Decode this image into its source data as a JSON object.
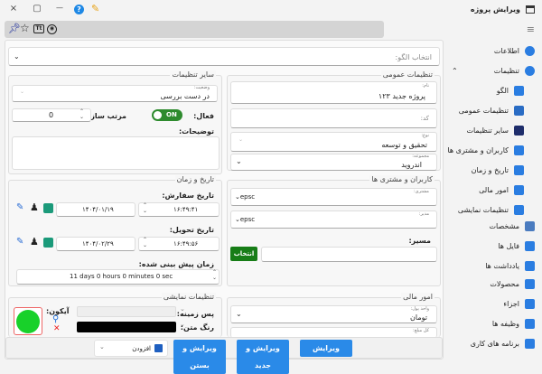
{
  "window": {
    "title": "ویرایش پروژه",
    "close": "×",
    "maximize": "▢",
    "minimize": "—",
    "help": "?"
  },
  "toolbar": {
    "icons": [
      "pin-icon",
      "star-icon",
      "text-format-icon",
      "eye-icon"
    ]
  },
  "pattern": {
    "placeholder": "انتخاب الگو:"
  },
  "general": {
    "title": "تنظیمات عمومی",
    "name_label": "نام:",
    "name_value": "پروژه جدید ۱۲۳",
    "code_label": "کد:",
    "type_label": "نوع:",
    "type_value": "تحقیق و توسعه",
    "group_label": "مجموعه:",
    "group_value": "اندروید"
  },
  "other": {
    "title": "سایر تنظیمات",
    "status_label": "وضعیت:",
    "status_value": "در دست بررسی",
    "active_label": "فعال:",
    "toggle_label": "ON",
    "toggle_on": true,
    "sort_label": "مرتب سازی:",
    "sort_value": "0",
    "desc_label": "توضیحات:"
  },
  "datetime": {
    "title": "تاریخ و زمان",
    "order_label": "تاریخ سفارش:",
    "order_date": "۱۴۰۴/۰۱/۱۹",
    "order_time": "۱۶:۴۹:۴۱",
    "delivery_label": "تاریخ تحویل:",
    "delivery_date": "۱۴۰۴/۰۲/۲۹",
    "delivery_time": "۱۶:۴۹:۵۶",
    "duration_label": "زمان پیش بینی شده:",
    "duration_value": "11 days 0 hours 0 minutes 0 sec"
  },
  "users": {
    "title": "کاربران و مشتری ها",
    "customer_label": "مشتری:",
    "customer_value": "epsc",
    "manager_label": "مدیر:",
    "manager_value": "epsc",
    "path_label": "مسیر:",
    "select_button": "انتخاب"
  },
  "finance": {
    "title": "امور مالی",
    "currency_label": "واحد پول:",
    "currency_value": "تومان",
    "total_label": "کل مبلغ:"
  },
  "display": {
    "title": "تنظیمات نمایشی",
    "icon_label": "آیکون:",
    "bg_label": "پس زمینه:",
    "text_color_label": "رنگ متن:",
    "icon_color": "#18d12a",
    "text_color": "#000000"
  },
  "footer": {
    "edit": "ویرایش",
    "edit_new": "ویرایش و جدید",
    "edit_close": "ویرایش و بستن",
    "add": "افزودن"
  },
  "sidebar": {
    "items": [
      {
        "label": "اطلاعات",
        "icon": "info-icon",
        "color": "#2a7de1"
      },
      {
        "label": "تنظیمات",
        "icon": "gear-icon",
        "color": "#2a7de1",
        "expanded": true
      },
      {
        "label": "الگو",
        "icon": "layout-icon",
        "color": "#2a7de1"
      },
      {
        "label": "تنظیمات عمومی",
        "icon": "sliders-icon",
        "color": "#2a6cc4"
      },
      {
        "label": "سایر تنظیمات",
        "icon": "cog-icon",
        "color": "#1e2d6b"
      },
      {
        "label": "کاربران و مشتری ها",
        "icon": "users-icon",
        "color": "#2a7de1"
      },
      {
        "label": "تاریخ و زمان",
        "icon": "clock-gear-icon",
        "color": "#2a7de1"
      },
      {
        "label": "امور مالی",
        "icon": "finance-gear-icon",
        "color": "#2a7de1"
      },
      {
        "label": "تنظیمات نمایشی",
        "icon": "monitor-icon",
        "color": "#2a7de1"
      },
      {
        "label": "مشخصات",
        "icon": "spec-icon",
        "color": "#4a7bbf"
      },
      {
        "label": "فایل ها",
        "icon": "folder-icon",
        "color": "#2a7de1"
      },
      {
        "label": "یادداشت ها",
        "icon": "note-icon",
        "color": "#2a7de1"
      },
      {
        "label": "محصولات",
        "icon": "grid-icon",
        "color": "#2a7de1"
      },
      {
        "label": "اجزاء",
        "icon": "grid-icon",
        "color": "#2a7de1"
      },
      {
        "label": "وظیفه ها",
        "icon": "checklist-icon",
        "color": "#2a7de1"
      },
      {
        "label": "برنامه های کاری",
        "icon": "checklist-icon",
        "color": "#2a7de1"
      }
    ]
  }
}
